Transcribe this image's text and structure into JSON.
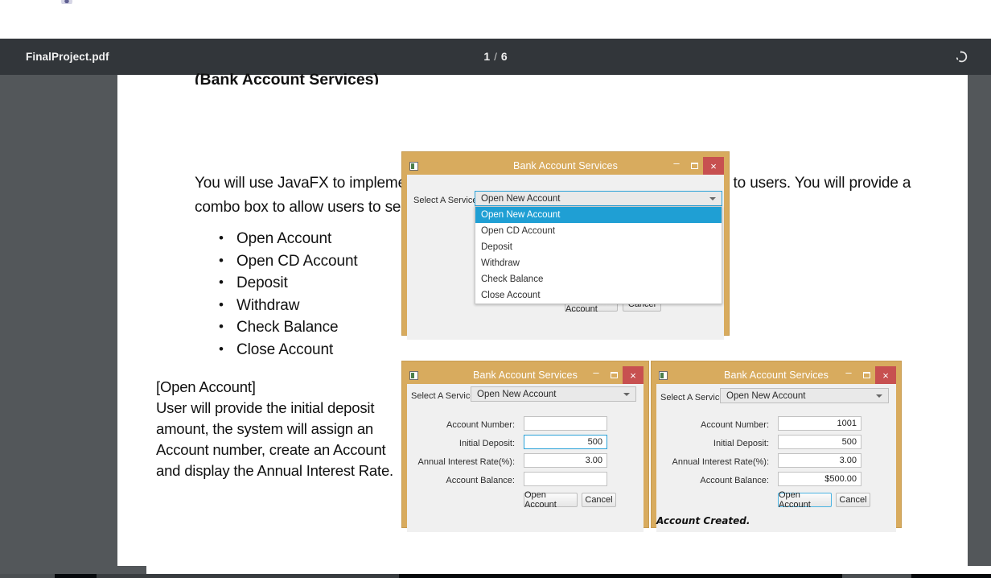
{
  "toolbar": {
    "file_name": "FinalProject.pdf",
    "current_page": "1",
    "separator": "/",
    "total_pages": "6",
    "rotate_icon": "rotate-clockwise-icon"
  },
  "document": {
    "heading": "(Bank Account Services)",
    "paragraph": "You will use JavaFX to implement a GUI application to provide the bank services to users. You will provide a combo box to allow users to select a services from this following list.",
    "services": [
      "Open Account",
      "Open CD Account",
      "Deposit",
      "Withdraw",
      "Check Balance",
      "Close Account"
    ],
    "side_note": "[Open Account]\nUser will provide the initial deposit amount, the system will assign an Account number, create an Account and display the Annual Interest Rate."
  },
  "dialog_dropdown": {
    "title": "Bank Account Services",
    "window_icon": "app-window-icon",
    "minimize_label": "–",
    "maximize_label": "□",
    "close_label": "×",
    "service_label": "Select A Service:",
    "service_value": "Open New Account",
    "options": [
      "Open New Account",
      "Open CD Account",
      "Deposit",
      "Withdraw",
      "Check Balance",
      "Close Account"
    ],
    "selected_option": "Open New Account",
    "open_button": "Open Account",
    "cancel_button": "Cancel"
  },
  "dialog_before": {
    "title": "Bank Account Services",
    "window_icon": "app-window-icon",
    "minimize_label": "–",
    "maximize_label": "□",
    "close_label": "×",
    "service_label": "Select A Service:",
    "service_value": "Open New Account",
    "fields": [
      {
        "label": "Account Number:",
        "value": ""
      },
      {
        "label": "Initial Deposit:",
        "value": "500"
      },
      {
        "label": "Annual Interest Rate(%):",
        "value": "3.00"
      },
      {
        "label": "Account Balance:",
        "value": ""
      }
    ],
    "open_button": "Open Account",
    "cancel_button": "Cancel"
  },
  "dialog_after": {
    "title": "Bank Account Services",
    "window_icon": "app-window-icon",
    "minimize_label": "–",
    "maximize_label": "□",
    "close_label": "×",
    "service_label": "Select A Service:",
    "service_value": "Open New Account",
    "fields": [
      {
        "label": "Account Number:",
        "value": "1001"
      },
      {
        "label": "Initial Deposit:",
        "value": "500"
      },
      {
        "label": "Annual Interest Rate(%):",
        "value": "3.00"
      },
      {
        "label": "Account Balance:",
        "value": "$500.00"
      }
    ],
    "open_button": "Open Account",
    "cancel_button": "Cancel",
    "status_message": "Account Created."
  },
  "colors": {
    "toolbar_bg": "#32363a",
    "viewer_bg": "#53575a",
    "window_chrome": "#d8ab5e",
    "close_button": "#c75050",
    "highlight": "#1f9fd4",
    "focus_border": "#2aa1d8"
  }
}
